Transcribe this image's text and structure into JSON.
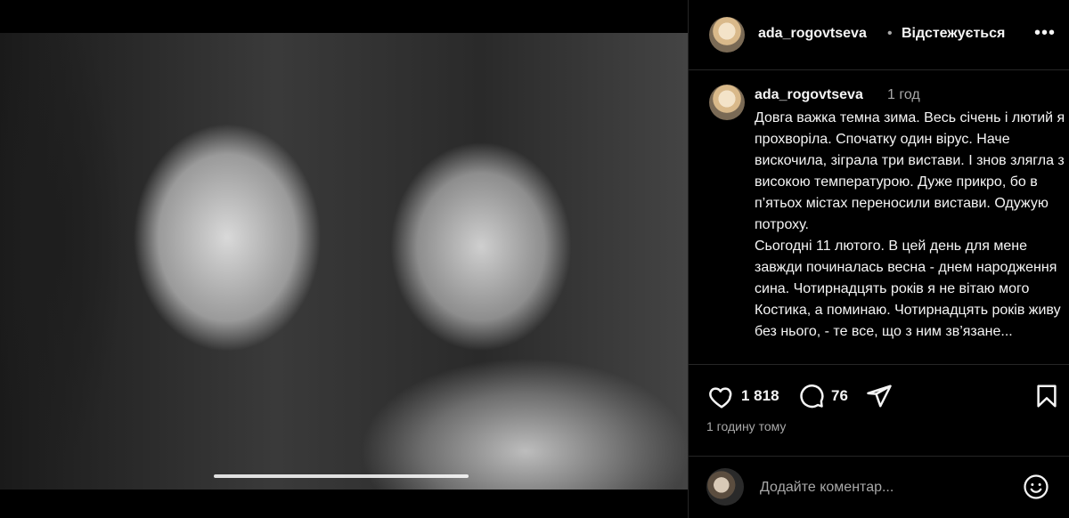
{
  "post": {
    "username": "ada_rogovtseva",
    "separator": "•",
    "follow_status": "Відстежується",
    "more_icon": "more-horizontal-icon"
  },
  "caption": {
    "username": "ada_rogovtseva",
    "time": "1 год",
    "text": "Довга важка темна зима.  Весь січень і лютий я прохворіла. Спочатку один вірус. Наче вискочила, зіграла три вистави. І знов злягла з високою температурою. Дуже прикро, бо в п’ятьох містах переносили вистави. Одужую потроху.\nСьогодні 11 лютого. В цей день для мене завжди починалась весна - днем народження сина. Чотирнадцять років я не вітаю мого Костика, а поминаю. Чотирнадцять років живу без нього, - те все, що з ним зв’язане..."
  },
  "actions": {
    "likes": "1 818",
    "comments": "76",
    "posted": "1 годину тому",
    "icons": [
      "heart-icon",
      "comment-icon",
      "share-icon",
      "save-icon"
    ]
  },
  "comment_box": {
    "placeholder": "Додайте коментар...",
    "emoji_icon": "emoji-icon"
  },
  "colors": {
    "background": "#000000",
    "text": "#f5f5f5",
    "secondary": "#a8a8a8",
    "divider": "#262626"
  },
  "media": {
    "carousel_progress": 0.37
  }
}
